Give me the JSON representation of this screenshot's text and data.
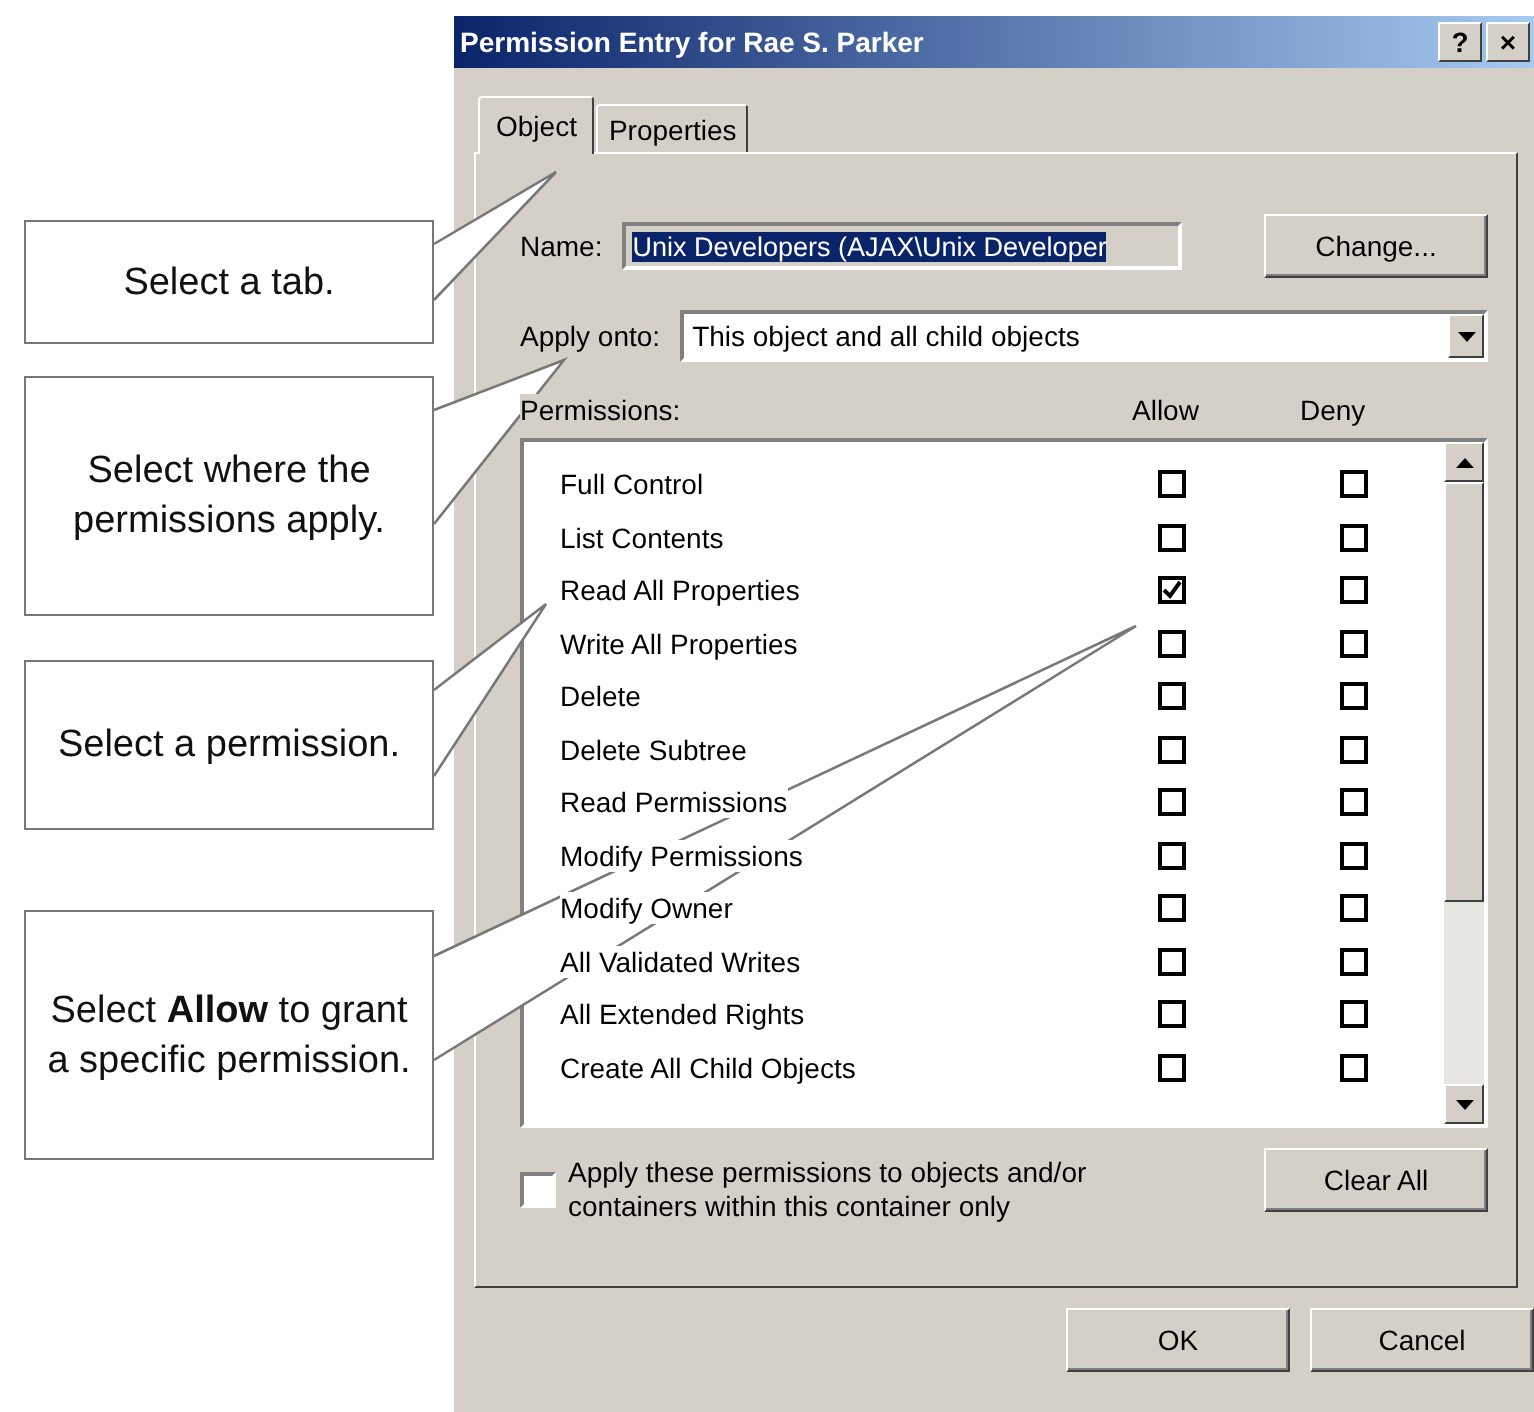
{
  "window": {
    "title": "Permission Entry for Rae S. Parker",
    "help_button": "?",
    "close_button": "×"
  },
  "tabs": [
    {
      "label": "Object",
      "selected": true
    },
    {
      "label": "Properties",
      "selected": false
    }
  ],
  "name": {
    "label": "Name:",
    "value": "Unix Developers (AJAX\\Unix Developer",
    "button": "Change..."
  },
  "apply_onto": {
    "label": "Apply onto:",
    "value": "This object and all child objects"
  },
  "permissions": {
    "label": "Permissions:",
    "columns": [
      "Allow",
      "Deny"
    ],
    "rows": [
      {
        "name": "Full Control",
        "allow": false,
        "deny": false
      },
      {
        "name": "List Contents",
        "allow": false,
        "deny": false
      },
      {
        "name": "Read All Properties",
        "allow": true,
        "deny": false
      },
      {
        "name": "Write All Properties",
        "allow": false,
        "deny": false
      },
      {
        "name": "Delete",
        "allow": false,
        "deny": false
      },
      {
        "name": "Delete Subtree",
        "allow": false,
        "deny": false
      },
      {
        "name": "Read Permissions",
        "allow": false,
        "deny": false
      },
      {
        "name": "Modify Permissions",
        "allow": false,
        "deny": false
      },
      {
        "name": "Modify Owner",
        "allow": false,
        "deny": false
      },
      {
        "name": "All Validated Writes",
        "allow": false,
        "deny": false
      },
      {
        "name": "All Extended Rights",
        "allow": false,
        "deny": false
      },
      {
        "name": "Create All Child Objects",
        "allow": false,
        "deny": false
      }
    ]
  },
  "apply_only": {
    "label": "Apply these permissions to objects and/or containers within this container only",
    "checked": false
  },
  "clear_button": "Clear All",
  "buttons": [
    "OK",
    "Cancel"
  ],
  "callouts": [
    {
      "text": "Select a tab."
    },
    {
      "text": "Select where the permissions apply."
    },
    {
      "text": "Select a permission."
    },
    {
      "text": "Select **Allow** to grant a specific permission."
    }
  ]
}
